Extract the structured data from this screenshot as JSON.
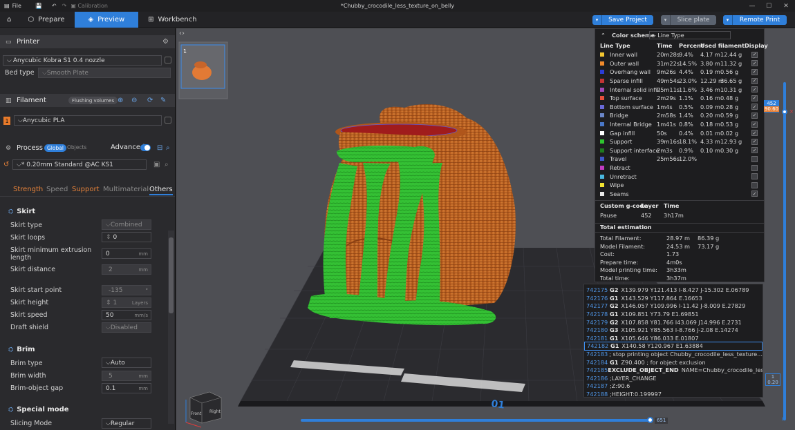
{
  "window": {
    "menu_file": "File",
    "calibration": "Calibration",
    "title": "*Chubby_crocodile_less_texture_on_belly"
  },
  "tabs": {
    "prepare": "Prepare",
    "preview": "Preview",
    "workbench": "Workbench"
  },
  "actions": {
    "save_project": "Save Project",
    "slice_plate": "Slice plate",
    "remote_print": "Remote Print"
  },
  "printer": {
    "section": "Printer",
    "name": "Anycubic Kobra S1 0.4 nozzle",
    "bed_type_label": "Bed type",
    "bed_type_value": "Smooth Plate"
  },
  "filament": {
    "section": "Filament",
    "flushing": "Flushing volumes",
    "slot": "1",
    "name": "Anycubic PLA"
  },
  "process": {
    "section": "Process",
    "global": "Global",
    "objects": "Objects",
    "advanced": "Advanced",
    "profile": "* 0.20mm Standard @AC KS1",
    "tabs": [
      "Strength",
      "Speed",
      "Support",
      "Multimaterial",
      "Others"
    ]
  },
  "skirt": {
    "header": "Skirt",
    "type_label": "Skirt type",
    "type_value": "Combined",
    "loops_label": "Skirt loops",
    "loops_value": "0",
    "minext_label_1": "Skirt minimum extrusion",
    "minext_label_2": "length",
    "minext_value": "0",
    "minext_unit": "mm",
    "distance_label": "Skirt distance",
    "distance_value": "2",
    "distance_unit": "mm",
    "start_label": "Skirt start point",
    "start_value": "-135",
    "height_label": "Skirt height",
    "height_value": "1",
    "height_unit": "Layers",
    "speed_label": "Skirt speed",
    "speed_value": "50",
    "speed_unit": "mm/s",
    "draft_label": "Draft shield",
    "draft_value": "Disabled"
  },
  "brim": {
    "header": "Brim",
    "type_label": "Brim type",
    "type_value": "Auto",
    "width_label": "Brim width",
    "width_value": "5",
    "width_unit": "mm",
    "gap_label": "Brim-object gap",
    "gap_value": "0.1",
    "gap_unit": "mm"
  },
  "special": {
    "header": "Special mode",
    "slicing_label": "Slicing Mode",
    "slicing_value": "Regular"
  },
  "plate": {
    "number": "1",
    "bed_text": "PLA / ABS / PETG / ASA",
    "bed_brand": "ANYCUBIC",
    "plate_label": "01"
  },
  "legend": {
    "scheme_label": "Color scheme",
    "scheme_value": "Line Type",
    "headers": [
      "Line Type",
      "Time",
      "Percent",
      "Used filament",
      "Display"
    ],
    "rows": [
      {
        "name": "Inner wall",
        "time": "20m28s",
        "pct": "9.4%",
        "len": "4.17 m",
        "wt": "12.44 g",
        "color": "#f2c531",
        "on": true
      },
      {
        "name": "Outer wall",
        "time": "31m22s",
        "pct": "14.5%",
        "len": "3.80 m",
        "wt": "11.32 g",
        "color": "#f28b2c",
        "on": true
      },
      {
        "name": "Overhang wall",
        "time": "9m26s",
        "pct": "4.4%",
        "len": "0.19 m",
        "wt": "0.56 g",
        "color": "#2b3cd6",
        "on": true
      },
      {
        "name": "Sparse infill",
        "time": "49m54s",
        "pct": "23.0%",
        "len": "12.29 m",
        "wt": "36.65 g",
        "color": "#c33535",
        "on": true
      },
      {
        "name": "Internal solid infill",
        "time": "25m11s",
        "pct": "11.6%",
        "len": "3.46 m",
        "wt": "10.31 g",
        "color": "#a04ab8",
        "on": true
      },
      {
        "name": "Top surface",
        "time": "2m29s",
        "pct": "1.1%",
        "len": "0.16 m",
        "wt": "0.48 g",
        "color": "#e8503c",
        "on": true
      },
      {
        "name": "Bottom surface",
        "time": "1m4s",
        "pct": "0.5%",
        "len": "0.09 m",
        "wt": "0.28 g",
        "color": "#6a6ad8",
        "on": true
      },
      {
        "name": "Bridge",
        "time": "2m58s",
        "pct": "1.4%",
        "len": "0.20 m",
        "wt": "0.59 g",
        "color": "#6a86c8",
        "on": true
      },
      {
        "name": "Internal Bridge",
        "time": "1m41s",
        "pct": "0.8%",
        "len": "0.18 m",
        "wt": "0.53 g",
        "color": "#4a78c8",
        "on": true
      },
      {
        "name": "Gap infill",
        "time": "50s",
        "pct": "0.4%",
        "len": "0.01 m",
        "wt": "0.02 g",
        "color": "#ffffff",
        "on": true
      },
      {
        "name": "Support",
        "time": "39m16s",
        "pct": "18.1%",
        "len": "4.33 m",
        "wt": "12.93 g",
        "color": "#2fc52f",
        "on": true
      },
      {
        "name": "Support interface",
        "time": "2m3s",
        "pct": "0.9%",
        "len": "0.10 m",
        "wt": "0.30 g",
        "color": "#1e7a1e",
        "on": true
      },
      {
        "name": "Travel",
        "time": "25m56s",
        "pct": "12.0%",
        "len": "",
        "wt": "",
        "color": "#3f58c8",
        "on": false
      },
      {
        "name": "Retract",
        "time": "",
        "pct": "",
        "len": "",
        "wt": "",
        "color": "#c43cc4",
        "on": false
      },
      {
        "name": "Unretract",
        "time": "",
        "pct": "",
        "len": "",
        "wt": "",
        "color": "#4ab8e0",
        "on": false
      },
      {
        "name": "Wipe",
        "time": "",
        "pct": "",
        "len": "",
        "wt": "",
        "color": "#f2e231",
        "on": false
      },
      {
        "name": "Seams",
        "time": "",
        "pct": "",
        "len": "",
        "wt": "",
        "color": "#e8e8e8",
        "on": true
      }
    ],
    "custom_h": [
      "Custom g-code",
      "Layer",
      "Time"
    ],
    "custom_row": {
      "name": "Pause",
      "layer": "452",
      "time": "3h17m"
    },
    "total_h": "Total estimation",
    "totals": [
      {
        "label": "Total Filament:",
        "a": "28.97 m",
        "b": "86.39 g"
      },
      {
        "label": "Model Filament:",
        "a": "24.53 m",
        "b": "73.17 g"
      },
      {
        "label": "Cost:",
        "a": "1.73",
        "b": ""
      },
      {
        "label": "Prepare time:",
        "a": "4m0s",
        "b": ""
      },
      {
        "label": "Model printing time:",
        "a": "3h33m",
        "b": ""
      },
      {
        "label": "Total time:",
        "a": "3h37m",
        "b": ""
      }
    ]
  },
  "gcode": [
    {
      "n": "742175",
      "c": "G2",
      "a": "X139.979 Y121.413 I-8.427 J-15.302 E.06789"
    },
    {
      "n": "742176",
      "c": "G1",
      "a": "X143.529 Y117.864 E.16653"
    },
    {
      "n": "742177",
      "c": "G2",
      "a": "X146.057 Y109.996 I-11.42 J-8.009 E.27829"
    },
    {
      "n": "742178",
      "c": "G1",
      "a": "X109.851 Y73.79 E1.69851"
    },
    {
      "n": "742179",
      "c": "G2",
      "a": "X107.858 Y81.766 I43.069 J14.996 E.2731"
    },
    {
      "n": "742180",
      "c": "G3",
      "a": "X105.921 Y85.563 I-8.766 J-2.08 E.14274"
    },
    {
      "n": "742181",
      "c": "G1",
      "a": "X105.646 Y86.033 E.01807"
    },
    {
      "n": "742182",
      "c": "G1",
      "a": "X140.58 Y120.967 E1.63884"
    },
    {
      "n": "742183",
      "c": "",
      "a": "; stop printing object Chubby_crocodile_less_texture..."
    },
    {
      "n": "742184",
      "c": "G1",
      "a": "Z90.400 ; for object exclusion"
    },
    {
      "n": "742185",
      "c": "EXCLUDE_OBJECT_END",
      "a": "NAME=Chubby_crocodile_less_textur..."
    },
    {
      "n": "742186",
      "c": "",
      "a": ";LAYER_CHANGE"
    },
    {
      "n": "742187",
      "c": "",
      "a": ";Z:90.6"
    },
    {
      "n": "742188",
      "c": "",
      "a": ";HEIGHT:0.199997"
    }
  ],
  "sliders": {
    "top_layer": "452",
    "top_height": "90.60",
    "bottom_layer": "1",
    "bottom_height": "0.20",
    "move_end": "651",
    "layer_progress": 1.0,
    "move_progress": 1.0
  },
  "viewcube": {
    "front": "Front",
    "right": "Right"
  },
  "colors": {
    "accent": "#2f7fda",
    "support": "#2fc52f",
    "wall": "#d4732b",
    "warn": "#e8833a"
  }
}
